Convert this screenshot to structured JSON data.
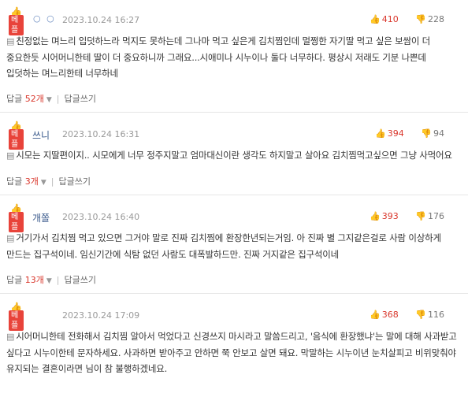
{
  "comments": [
    {
      "badge": "베플",
      "author": "○ ○",
      "date": "2023.10.24 16:27",
      "up": "410",
      "down": "228",
      "body": "친정없는 며느리 입덧하느라 먹지도 못하는데 그나마 먹고 싶은게 김치찜인데 멀쩡한 자기딸 먹고 싶은 보쌈이 더 중요한듯 시어머니한테 딸이 더 중요하니까 그래요...시애미나 시누이나 둘다 너무하다. 평상시 저래도 기분 나쁜데 입덧하는 며느리한테 너무하네",
      "reply_label": "답글",
      "reply_count": "52개",
      "write_reply": "답글쓰기"
    },
    {
      "badge": "베플",
      "author": "쓰니",
      "date": "2023.10.24 16:31",
      "up": "394",
      "down": "94",
      "body": "시모는 지딸편이지.. 시모에게 너무 정주지말고 엄마대신이란 생각도 하지말고 살아요 김치찜먹고싶으면 그냥 사먹어요",
      "reply_label": "답글",
      "reply_count": "3개",
      "write_reply": "답글쓰기"
    },
    {
      "badge": "베플",
      "author": "개쫄",
      "date": "2023.10.24 16:40",
      "up": "393",
      "down": "176",
      "body": "거기가서 김치찜 먹고 있으면 그거야 말로 진짜 김치찜에 환장한년되는거임. 아 진짜 별 그지같은걸로 사람 이상하게 만드는 집구석이네. 임신기간에 식탐 없던 사람도 대폭발하드만. 진짜 거지같은 집구석이네",
      "reply_label": "답글",
      "reply_count": "13개",
      "write_reply": "답글쓰기"
    },
    {
      "badge": "베플",
      "author": "",
      "date": "2023.10.24 17:09",
      "up": "368",
      "down": "116",
      "body": "시어머니한테 전화해서 김치찜 알아서 먹었다고 신경쓰지 마시라고 말씀드리고, '음식에 환장했냐'는 말에 대해 사과받고 싶다고 시누이한테 문자하세요. 사과하면 받아주고 안하면 쭉 안보고 살면 돼요. 막말하는 시누이년 눈치살피고 비위맞춰야 유지되는 결혼이라면 님이 참 불행하겠네요.",
      "reply_label": "",
      "reply_count": "",
      "write_reply": ""
    }
  ]
}
